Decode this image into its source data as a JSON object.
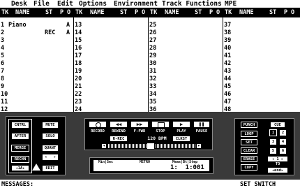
{
  "menu": [
    "Desk",
    "File",
    "Edit",
    "Options",
    "Environment",
    "Track Functions",
    "MPE"
  ],
  "header": {
    "tk": "TK",
    "name": "NAME",
    "st": "ST",
    "p": "P",
    "o": "O"
  },
  "tracks": [
    {
      "num": "1",
      "name": "Piano",
      "st": "",
      "o": "A"
    },
    {
      "num": "2",
      "name": "",
      "st": "REC",
      "o": "A"
    },
    {
      "num": "3",
      "name": "",
      "st": "",
      "o": ""
    },
    {
      "num": "4",
      "name": "",
      "st": "",
      "o": ""
    },
    {
      "num": "5",
      "name": "",
      "st": "",
      "o": ""
    },
    {
      "num": "6",
      "name": "",
      "st": "",
      "o": ""
    },
    {
      "num": "7",
      "name": "",
      "st": "",
      "o": ""
    },
    {
      "num": "8",
      "name": "",
      "st": "",
      "o": ""
    },
    {
      "num": "9",
      "name": "",
      "st": "",
      "o": ""
    },
    {
      "num": "10",
      "name": "",
      "st": "",
      "o": ""
    },
    {
      "num": "11",
      "name": "",
      "st": "",
      "o": ""
    },
    {
      "num": "12",
      "name": "",
      "st": "",
      "o": ""
    }
  ],
  "track_cols": [
    [
      "13",
      "14",
      "15",
      "16",
      "17",
      "18",
      "19",
      "20",
      "21",
      "22",
      "23",
      "24"
    ],
    [
      "25",
      "26",
      "27",
      "28",
      "29",
      "30",
      "31",
      "32",
      "33",
      "34",
      "35",
      "36"
    ],
    [
      "37",
      "38",
      "39",
      "40",
      "41",
      "42",
      "43",
      "44",
      "45",
      "46",
      "47",
      "48"
    ]
  ],
  "left_panel": {
    "cntrl": "CNTRL",
    "after": "AFTER",
    "merge": "MERGE",
    "rechn": "RECHN",
    "channel": "1A",
    "mute": "MUTE",
    "solo": "SOLO",
    "quant": "QUANT",
    "edit": "EDIT"
  },
  "transport": {
    "record": "RECORD",
    "rewind": "REWIND",
    "ffwd": "F-FWD",
    "stop": "STOP",
    "play": "PLAY",
    "pause": "PAUSE",
    "rrec": "R-REC",
    "tempo": "120",
    "bpm": "BPM",
    "clkst": "CLKST"
  },
  "counter": {
    "minsec": "Min|Sec",
    "metro": "METRO",
    "meas_label": "Meas|Bt|Step",
    "position": "1:  1:001"
  },
  "right_panel": {
    "punch": "PUNCH",
    "cue": "CUE",
    "loop": "LOOP",
    "set": "SET",
    "clear": "CLEAR",
    "erase": "ERASE",
    "copy": "COPY",
    "nums": [
      "1",
      "2",
      "3",
      "4",
      "5",
      "6"
    ],
    "field": "1",
    "to": "TO",
    "end": "end"
  },
  "status": {
    "messages": "MESSAGES:",
    "right": "SET SWITCH"
  }
}
